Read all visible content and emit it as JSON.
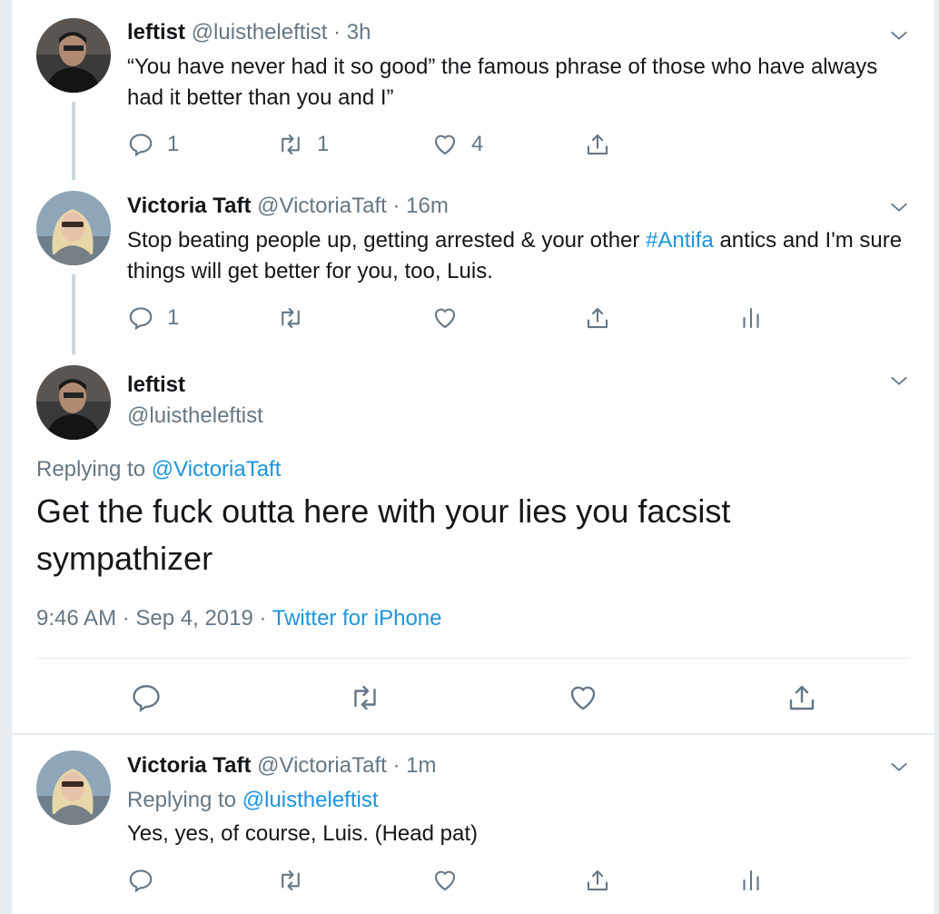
{
  "tweets": {
    "t1": {
      "name": "leftist",
      "handle": "@luistheleftist",
      "sep": "·",
      "time": "3h",
      "text": "“You have never had it so good” the famous phrase of those who have always had it better than you and I”",
      "replies": "1",
      "retweets": "1",
      "likes": "4"
    },
    "t2": {
      "name": "Victoria Taft",
      "handle": "@VictoriaTaft",
      "sep": "·",
      "time": "16m",
      "text_before": "Stop beating people up, getting arrested & your other ",
      "hashtag": "#Antifa",
      "text_after": " antics and I'm sure things will get better for you, too, Luis.",
      "replies": "1"
    },
    "main": {
      "name": "leftist",
      "handle": "@luistheleftist",
      "replying_prefix": "Replying to ",
      "replying_to": "@VictoriaTaft",
      "text": "Get the fuck outta here with your lies you facsist sympathizer",
      "timestamp": "9:46 AM · Sep 4, 2019 ·",
      "source": "Twitter for iPhone"
    },
    "t4": {
      "name": "Victoria Taft",
      "handle": "@VictoriaTaft",
      "sep": "·",
      "time": "1m",
      "replying_prefix": "Replying to ",
      "replying_to": "@luistheleftist",
      "text": "Yes, yes, of course, Luis. (Head pat)"
    }
  },
  "colors": {
    "link": "#1b95e0",
    "secondary_text": "#657786",
    "thread_line": "#ccd6dd"
  },
  "icons": [
    "reply-icon",
    "retweet-icon",
    "like-icon",
    "share-icon",
    "analytics-icon",
    "chevron-down-icon"
  ]
}
